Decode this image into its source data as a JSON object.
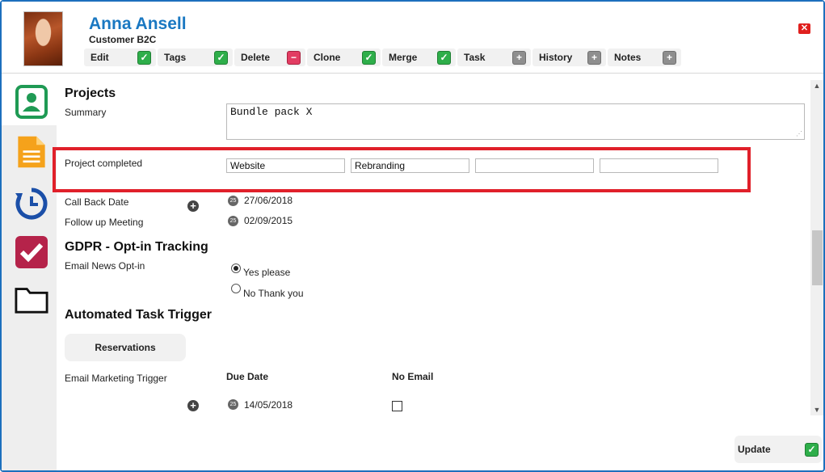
{
  "contact": {
    "name": "Anna Ansell",
    "type": "Customer B2C"
  },
  "toolbar": [
    {
      "label": "Edit",
      "icon": "check-icon",
      "color": "green"
    },
    {
      "label": "Tags",
      "icon": "check-icon",
      "color": "green"
    },
    {
      "label": "Delete",
      "icon": "minus-icon",
      "color": "red"
    },
    {
      "label": "Clone",
      "icon": "check-icon",
      "color": "green"
    },
    {
      "label": "Merge",
      "icon": "check-icon",
      "color": "green"
    },
    {
      "label": "Task",
      "icon": "plus-icon",
      "color": "gray"
    },
    {
      "label": "History",
      "icon": "plus-icon",
      "color": "gray"
    },
    {
      "label": "Notes",
      "icon": "plus-icon",
      "color": "gray"
    }
  ],
  "projects": {
    "heading": "Projects",
    "summary_label": "Summary",
    "summary_value": "Bundle pack X",
    "completed_label": "Project completed",
    "completed_values": [
      "Website",
      "Rebranding",
      "",
      ""
    ]
  },
  "dates": {
    "call_back_label": "Call Back Date",
    "call_back_value": "27/06/2018",
    "follow_up_label": "Follow up Meeting",
    "follow_up_value": "02/09/2015"
  },
  "gdpr": {
    "heading": "GDPR - Opt-in Tracking",
    "label": "Email News Opt-in",
    "option_yes": "Yes please",
    "option_no": "No Thank you",
    "selected": "Yes please"
  },
  "automated": {
    "heading": "Automated Task Trigger",
    "tab_label": "Reservations",
    "trigger_label": "Email Marketing Trigger",
    "due_date_header": "Due Date",
    "no_email_header": "No Email",
    "due_date_value": "14/05/2018",
    "no_email_checked": false
  },
  "footer": {
    "update_label": "Update"
  },
  "colors": {
    "accent": "#1a78c2",
    "highlight": "#e0202a",
    "green": "#2eae4a",
    "red": "#e23c62"
  }
}
